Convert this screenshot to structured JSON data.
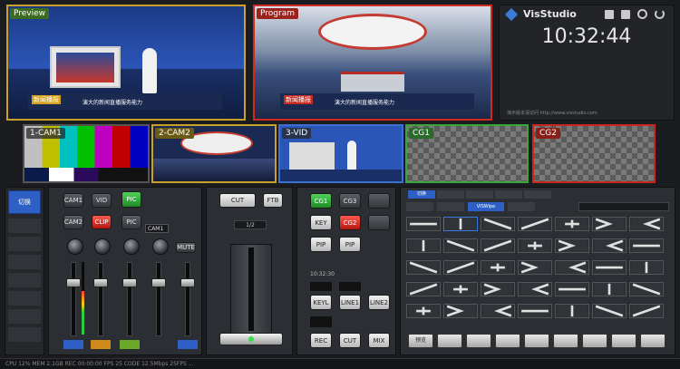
{
  "preview": {
    "label": "Preview",
    "lower_third_tag": "新闻播报",
    "lower_third_text": "演大的新闻直播服务能力"
  },
  "program": {
    "label": "Program",
    "lower_third_tag": "新闻播报",
    "lower_third_text": "演大的新闻直播服务能力"
  },
  "brand": {
    "name": "VisStudio",
    "clock": "10:32:44",
    "note": "演示版本请访问 http://www.visstudio.com"
  },
  "inputs": [
    {
      "label": "1-CAM1"
    },
    {
      "label": "2-CAM2"
    },
    {
      "label": "3-VID"
    },
    {
      "label": "CG1"
    },
    {
      "label": "CG2"
    }
  ],
  "left_tabs": [
    "切换",
    "",
    "",
    "",
    "",
    "",
    "",
    "",
    ""
  ],
  "source_buttons": [
    {
      "label": "CAM1"
    },
    {
      "label": "VID"
    },
    {
      "label": "PIC"
    },
    {
      "label": "CAM2"
    },
    {
      "label": "CLIP"
    },
    {
      "label": "PIC"
    }
  ],
  "audio": {
    "source_select": "CAM1",
    "mute_label": "MUTE",
    "channel_count": 5
  },
  "transition": {
    "cut_label": "CUT",
    "ftb_label": "FTB",
    "rate_label": "1/2"
  },
  "keys": [
    {
      "label": "CG1",
      "state": "green"
    },
    {
      "label": "CG3",
      "state": "dark"
    },
    {
      "label": "",
      "state": "dark"
    },
    {
      "label": "KEY",
      "state": "light"
    },
    {
      "label": "CG2",
      "state": "red"
    },
    {
      "label": "",
      "state": "dark"
    },
    {
      "label": "PIP",
      "state": "light"
    },
    {
      "label": "PIP",
      "state": "light"
    },
    {
      "label": "",
      "state": "dark"
    }
  ],
  "timecode_small": "10:32:30",
  "bottom_buttons": [
    {
      "label": "REC"
    },
    {
      "label": "CUT"
    },
    {
      "label": "MIX"
    }
  ],
  "mid_buttons": [
    {
      "label": "KEYL"
    },
    {
      "label": "LINE1"
    },
    {
      "label": "LINE2"
    }
  ],
  "transitions_panel": {
    "tabs": [
      "切换",
      "",
      "",
      "",
      "",
      ""
    ],
    "active_tab": 0,
    "subtabs": [
      "",
      "",
      "VISWipe",
      "",
      ""
    ],
    "rows": 5,
    "cols": 7,
    "label_prefix": "VTWipe"
  },
  "bottom_right_buttons": [
    "预览",
    "",
    "",
    "",
    "",
    "",
    "",
    "",
    ""
  ],
  "status_bar": "CPU 12%  MEM 2.1GB  REC 00:00:00  FPS 25  CODE 12.5Mbps  25FPS  ..."
}
